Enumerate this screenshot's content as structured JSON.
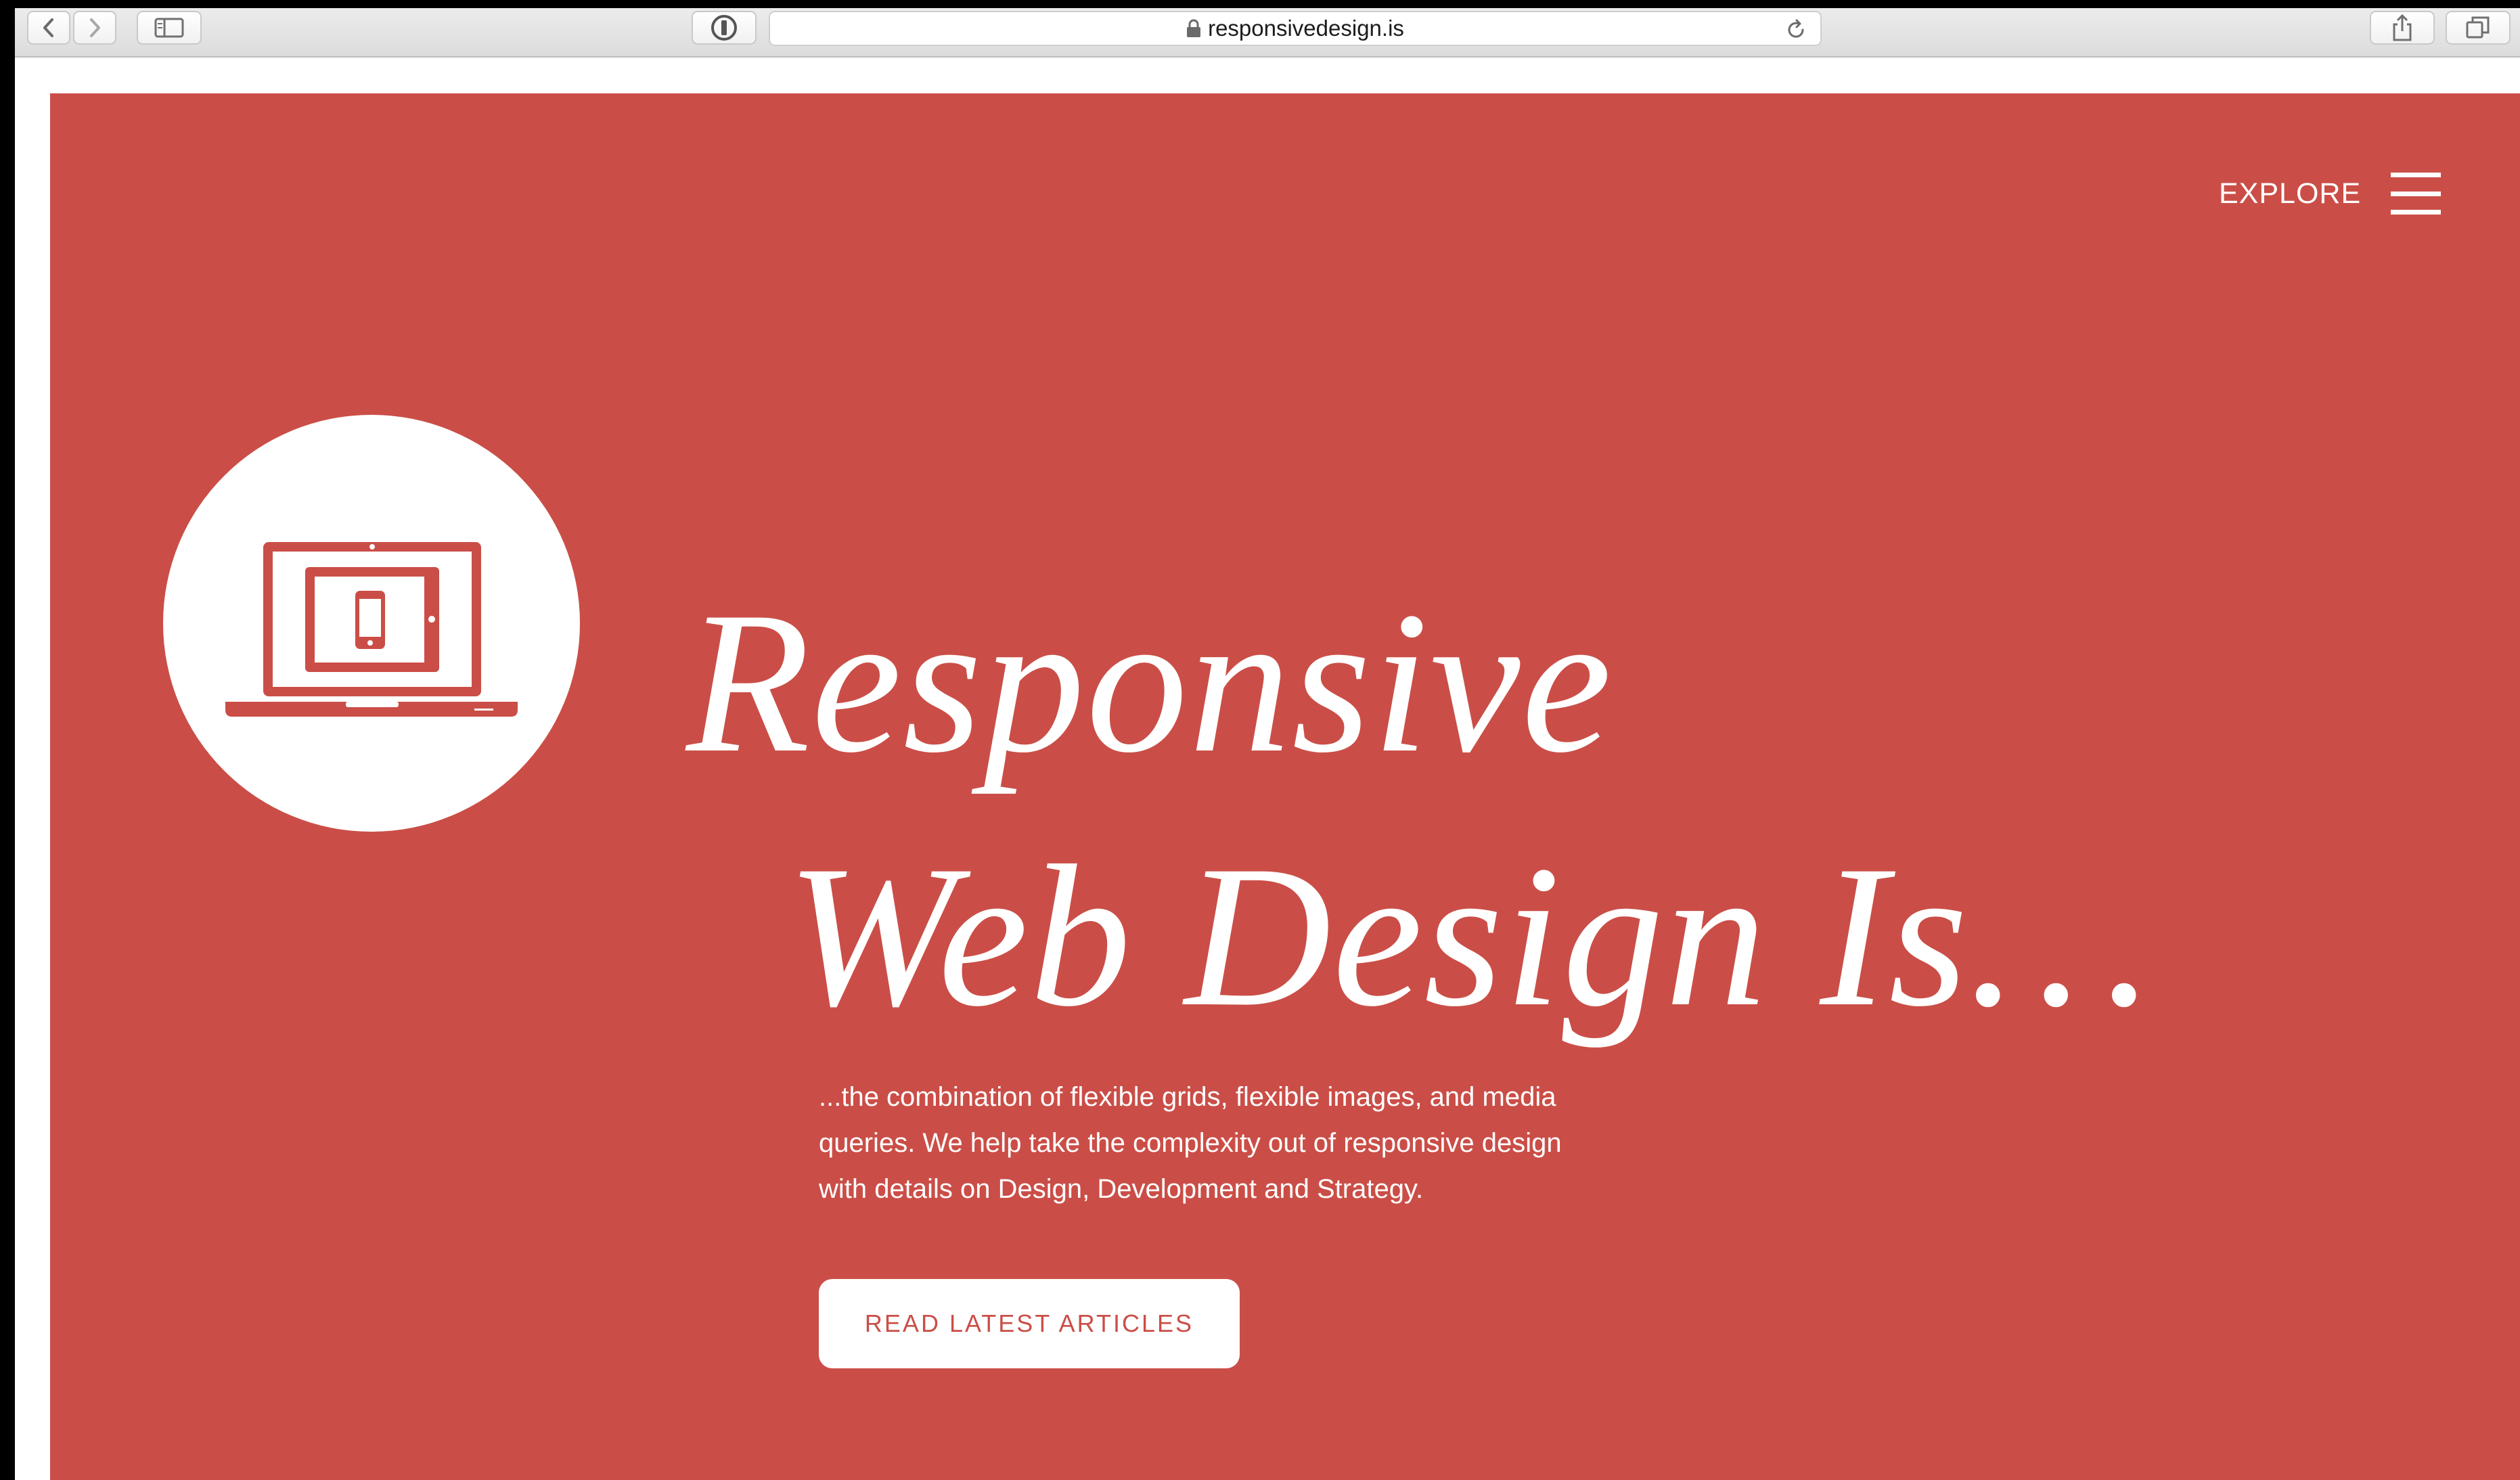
{
  "browser": {
    "url": "responsivedesign.is",
    "back_icon": "chevron-left-icon",
    "forward_icon": "chevron-right-icon",
    "sidebar_icon": "sidebar-icon",
    "password_icon": "password-manager-icon",
    "lock_icon": "lock-icon",
    "reload_icon": "reload-icon",
    "share_icon": "share-icon",
    "tabs_icon": "tabs-icon"
  },
  "nav": {
    "explore_label": "EXPLORE",
    "menu_icon": "hamburger-menu-icon"
  },
  "hero": {
    "logo_icon": "responsive-devices-icon",
    "headline_line1": "Responsive",
    "headline_line2": "Web Design Is…",
    "intro": "...the combination of flexible grids, flexible images, and media queries. We help take the complexity out of responsive design with details on Design, Development and Strategy.",
    "cta_label": "READ LATEST ARTICLES"
  },
  "colors": {
    "brand_red": "#ca4e47",
    "text_light": "#ffffff",
    "toolbar_bg": "#e4e4e4"
  }
}
